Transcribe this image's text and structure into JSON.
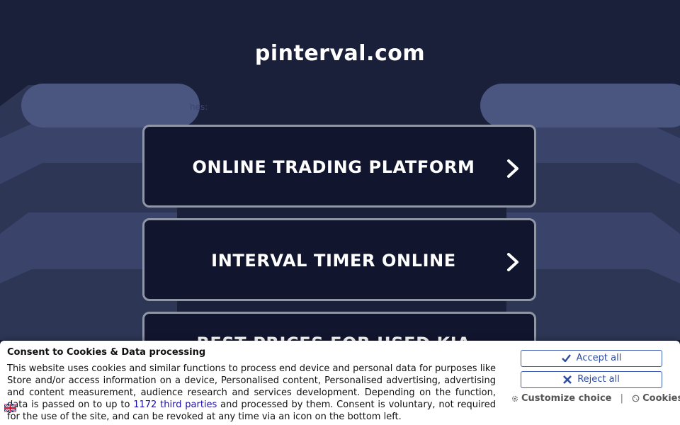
{
  "site": {
    "title": "pinterval.com",
    "related_hint": "hes:"
  },
  "links": [
    {
      "label": "ONLINE TRADING PLATFORM"
    },
    {
      "label": "INTERVAL TIMER ONLINE"
    },
    {
      "label": "BEST PRICES FOR USED KIA"
    }
  ],
  "consent": {
    "title": "Consent to Cookies & Data processing",
    "body_before": "This website uses cookies and similar functions to process end device and personal data for purposes like Store and/or access information on a device, Personalised content, Personalised advertising, advertising and content measurement, audience research and services development. Depending on the function, data is passed on to up to ",
    "third_parties_link": "1172 third parties",
    "body_after": " and processed by them. Consent is voluntary, not required for the use of the site, and can be revoked at any time via an icon on the bottom left.",
    "accept_label": "Accept all",
    "reject_label": "Reject all",
    "customize_label": "Customize choice",
    "separator": "|",
    "cookies_label": "Cookies"
  },
  "colors": {
    "background": "#1a1f3a",
    "box_fill": "#11152e",
    "box_border": "#8f96a6",
    "button_accent": "#2b4aa2"
  },
  "icons": {
    "chevron": "chevron-right-icon",
    "accept": "check-icon",
    "reject": "x-icon",
    "customize": "gear-icon",
    "cookies": "cookie-icon",
    "language": "uk-flag-icon"
  }
}
